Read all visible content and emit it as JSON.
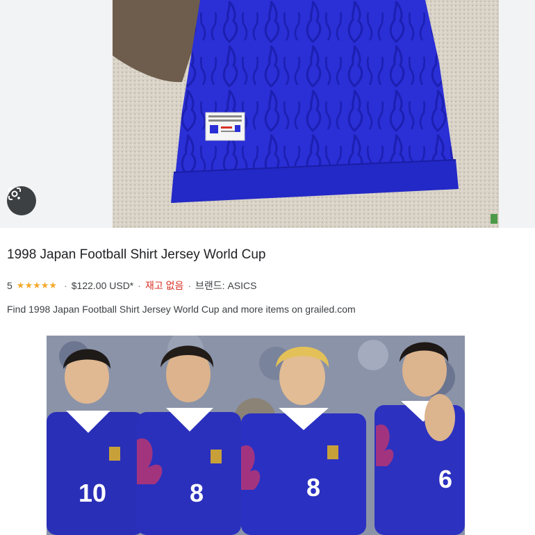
{
  "result": {
    "title": "1998 Japan Football Shirt Jersey World Cup",
    "rating": "5",
    "stars": "★★★★★",
    "separator": "·",
    "price": "$122.00 USD*",
    "stock_status": "재고 없음",
    "brand": "브랜드: ASICS",
    "description": "Find 1998 Japan Football Shirt Jersey World Cup and more items on grailed.com"
  },
  "colors": {
    "jersey_blue": "#2a2fd6",
    "star_color": "#f4a92c",
    "stock_color": "#d93025"
  },
  "icons": {
    "lens": "lens-search-icon"
  },
  "team_photo": {
    "player_numbers": [
      "10",
      "8",
      "8",
      "6"
    ]
  }
}
